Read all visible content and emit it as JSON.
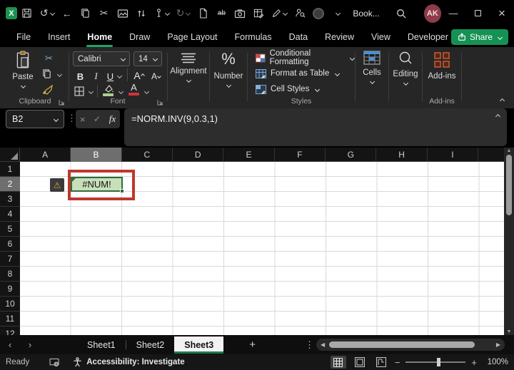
{
  "icons": {
    "percent": "%",
    "warning": "⚠",
    "scissors": "✂",
    "undo": "↺",
    "redo": "↻",
    "back": "←",
    "ellipsis": "⋮",
    "cancel": "×",
    "check": "✓",
    "chevron_left": "‹",
    "chevron_right": "›",
    "plus": "+",
    "minus": "−",
    "tri_up": "▲",
    "tri_down": "▼",
    "tri_left": "◀",
    "tri_right": "▶",
    "minimize": "—",
    "close": "×",
    "strikethrough_ab": "ab"
  },
  "titlebar": {
    "document_name": "Book...",
    "avatar_initials": "AK"
  },
  "menubar": {
    "items": [
      "File",
      "Insert",
      "Home",
      "Draw",
      "Page Layout",
      "Formulas",
      "Data",
      "Review",
      "View",
      "Developer",
      "Help"
    ],
    "active_item": "Home",
    "share_label": "Share"
  },
  "ribbon": {
    "clipboard": {
      "paste_label": "Paste",
      "group_label": "Clipboard"
    },
    "font": {
      "family": "Calibri",
      "size": "14",
      "bold": "B",
      "italic": "I",
      "underline": "U",
      "grow": "A",
      "shrink": "A",
      "color_letter": "A",
      "group_label": "Font"
    },
    "alignment_label": "Alignment",
    "number_label": "Number",
    "styles": {
      "items": [
        "Conditional Formatting",
        "Format as Table",
        "Cell Styles"
      ],
      "group_label": "Styles"
    },
    "cells_label": "Cells",
    "editing_label": "Editing",
    "addins_label": "Add-ins",
    "addins_group_label": "Add-ins"
  },
  "formula_bar": {
    "name_box": "B2",
    "fx_label": "fx",
    "formula": "=NORM.INV(9,0.3,1)"
  },
  "grid": {
    "columns": [
      "A",
      "B",
      "C",
      "D",
      "E",
      "F",
      "G",
      "H",
      "I"
    ],
    "rows": [
      "1",
      "2",
      "3",
      "4",
      "5",
      "6",
      "7",
      "8",
      "9",
      "10",
      "11",
      "12"
    ],
    "selected_column": "B",
    "selected_row": "2",
    "active_cell": {
      "ref": "B2",
      "value": "#NUM!"
    }
  },
  "sheet_tabs": {
    "tabs": [
      "Sheet1",
      "Sheet2",
      "Sheet3"
    ],
    "active": "Sheet3"
  },
  "status_bar": {
    "mode": "Ready",
    "accessibility": "Accessibility: Investigate",
    "zoom_level": "100%"
  },
  "colors": {
    "accent_green": "#21a366",
    "share_green": "#169154",
    "cell_fill_green": "#c8e0ba",
    "selection_border_green": "#2f6b3c",
    "annotation_red": "#bf372e",
    "warning_orange": "#e2a33c",
    "avatar_maroon": "#8e3b4a"
  }
}
